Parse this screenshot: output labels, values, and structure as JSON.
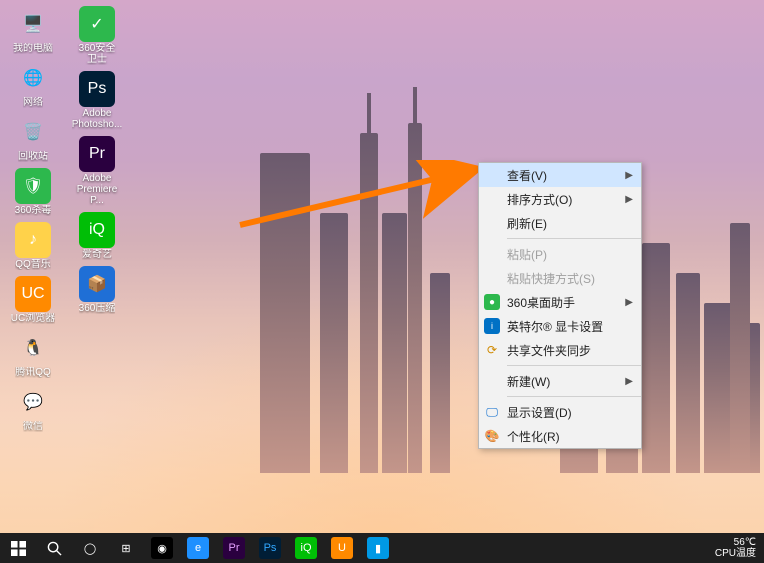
{
  "desktop_icons": {
    "col1": [
      {
        "name": "my-computer",
        "label": "我的电脑",
        "bg": "transparent",
        "glyph": "🖥️"
      },
      {
        "name": "network",
        "label": "网络",
        "bg": "transparent",
        "glyph": "🌐"
      },
      {
        "name": "recycle-bin",
        "label": "回收站",
        "bg": "transparent",
        "glyph": "🗑️"
      },
      {
        "name": "360-antivirus",
        "label": "360杀毒",
        "bg": "#2db84d",
        "glyph": "🛡"
      },
      {
        "name": "qq-music",
        "label": "QQ音乐",
        "bg": "#ffd24a",
        "glyph": "♪"
      },
      {
        "name": "uc-browser",
        "label": "UC浏览器",
        "bg": "#ff8a00",
        "glyph": "UC"
      },
      {
        "name": "tencent-qq",
        "label": "腾讯QQ",
        "bg": "transparent",
        "glyph": "🐧"
      },
      {
        "name": "wechat",
        "label": "微信",
        "bg": "transparent",
        "glyph": "💬"
      }
    ],
    "col2": [
      {
        "name": "360-safeguard",
        "label": "360安全卫士",
        "bg": "#2db84d",
        "glyph": "✓"
      },
      {
        "name": "adobe-photoshop",
        "label": "Adobe Photosho...",
        "bg": "#001e36",
        "glyph": "Ps"
      },
      {
        "name": "adobe-premiere",
        "label": "Adobe Premiere P...",
        "bg": "#2a003f",
        "glyph": "Pr"
      },
      {
        "name": "iqiyi",
        "label": "爱奇艺",
        "bg": "#00be06",
        "glyph": "iQ"
      },
      {
        "name": "360-zip",
        "label": "360压缩",
        "bg": "#1f6fd6",
        "glyph": "📦"
      }
    ]
  },
  "context_menu": {
    "view": "查看(V)",
    "sort": "排序方式(O)",
    "refresh": "刷新(E)",
    "paste": "粘贴(P)",
    "paste_shortcut": "粘贴快捷方式(S)",
    "desktop_helper": "360桌面助手",
    "intel_graphics": "英特尔® 显卡设置",
    "shared_sync": "共享文件夹同步",
    "new": "新建(W)",
    "display_settings": "显示设置(D)",
    "personalize": "个性化(R)"
  },
  "taskbar": {
    "apps": [
      {
        "name": "cortana-circle",
        "bg": "transparent",
        "color": "#fff",
        "glyph": "◯"
      },
      {
        "name": "task-view",
        "bg": "transparent",
        "color": "#fff",
        "glyph": "⊞"
      },
      {
        "name": "edge",
        "bg": "#000",
        "color": "#fff",
        "glyph": "◉"
      },
      {
        "name": "ie",
        "bg": "#1e90ff",
        "color": "#fff",
        "glyph": "e"
      },
      {
        "name": "premiere-pinned",
        "bg": "#2a003f",
        "color": "#e6a0ff",
        "glyph": "Pr"
      },
      {
        "name": "photoshop-pinned",
        "bg": "#001e36",
        "color": "#31a8ff",
        "glyph": "Ps"
      },
      {
        "name": "iqiyi-pinned",
        "bg": "#00be06",
        "color": "#fff",
        "glyph": "iQ"
      },
      {
        "name": "uc-pinned",
        "bg": "#ff8a00",
        "color": "#fff",
        "glyph": "U"
      },
      {
        "name": "phone-link",
        "bg": "#0099e5",
        "color": "#fff",
        "glyph": "▮"
      }
    ],
    "tray": {
      "temp_value": "56℃",
      "temp_label": "CPU温度"
    }
  }
}
